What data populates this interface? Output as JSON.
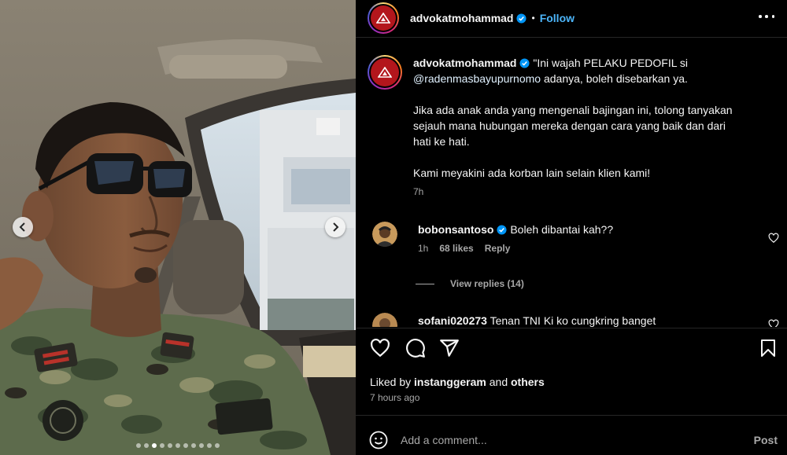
{
  "post": {
    "username": "advokatmohammad",
    "follow_label": "Follow",
    "separator": "•",
    "caption_lines": [
      "\"Ini wajah PELAKU PEDOFIL si",
      "adanya, boleh disebarkan ya.",
      "Jika ada anak anda yang mengenali bajingan ini, tolong tanyakan",
      "sejauh mana hubungan mereka dengan cara yang baik dan dari",
      "hati ke hati.",
      "Kami meyakini ada korban lain selain klien kami!"
    ],
    "caption_mention": "@radenmasbayupurnomo",
    "caption_age": "7h"
  },
  "comments": [
    {
      "username": "bobonsantoso",
      "text": "Boleh dibantai kah??",
      "age": "1h",
      "likes": "68 likes",
      "reply_label": "Reply",
      "view_replies": "View replies (14)"
    },
    {
      "username": "sofani020273",
      "text": "Tenan TNI Ki ko cungkring banget"
    }
  ],
  "footer": {
    "liked_by_prefix": "Liked by",
    "liked_by_user": "instanggeram",
    "liked_by_and": "and",
    "liked_by_others": "others",
    "timestamp": "7 hours ago",
    "comment_placeholder": "Add a comment...",
    "post_label": "Post"
  },
  "carousel": {
    "total_slides": 11,
    "active_index": 2
  },
  "icons": {
    "header": [
      "verified-icon",
      "more-options-icon"
    ],
    "actions": [
      "heart-icon",
      "comment-icon",
      "share-icon",
      "bookmark-icon"
    ],
    "composer": [
      "emoji-icon"
    ],
    "media": [
      "chevron-left-icon",
      "chevron-right-icon"
    ]
  },
  "colors": {
    "link": "#4cb5f9",
    "verified": "#0095f6",
    "muted": "#a8a8a8",
    "background": "#000000"
  }
}
